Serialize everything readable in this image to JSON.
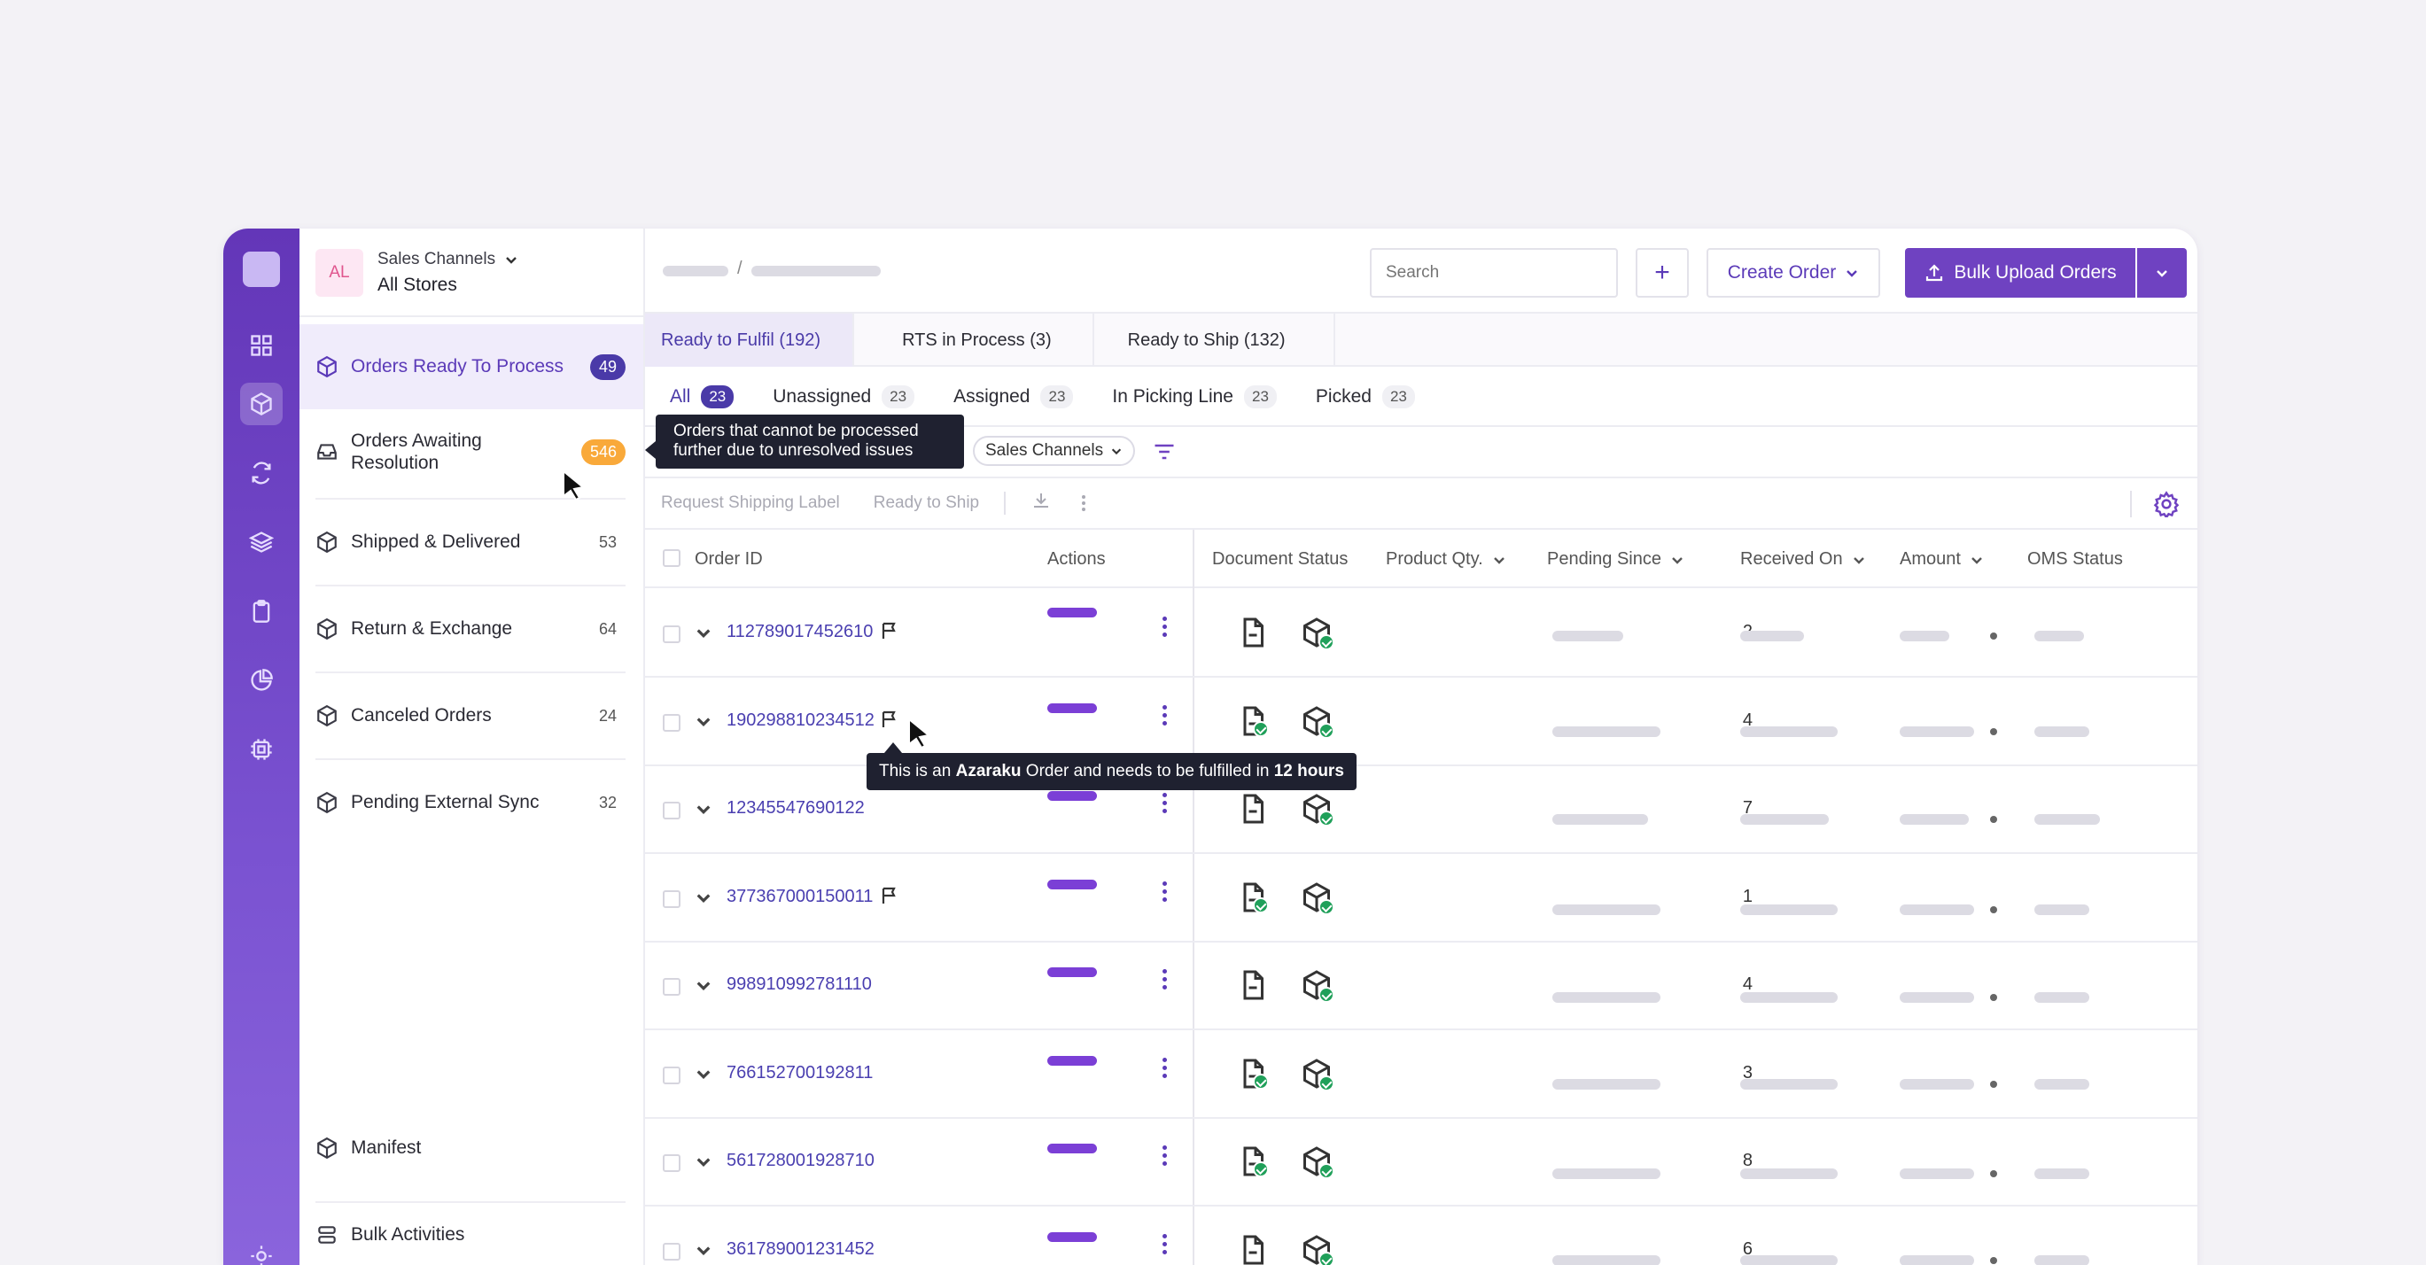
{
  "store": {
    "initials": "AL",
    "channel_label": "Sales Channels",
    "store_name": "All Stores"
  },
  "sidebar": {
    "items": [
      {
        "label": "Orders Ready To Process",
        "count": "49",
        "icon": "box-icon"
      },
      {
        "label": "Orders Awaiting Resolution",
        "count": "546",
        "icon": "inbox-icon"
      },
      {
        "label": "Shipped & Delivered",
        "count": "53",
        "icon": "box-icon"
      },
      {
        "label": "Return & Exchange",
        "count": "64",
        "icon": "box-icon"
      },
      {
        "label": "Canceled Orders",
        "count": "24",
        "icon": "box-icon"
      },
      {
        "label": "Pending External Sync",
        "count": "32",
        "icon": "box-icon"
      }
    ],
    "bottom": [
      {
        "label": "Manifest",
        "icon": "box-icon"
      },
      {
        "label": "Bulk Activities",
        "icon": "stack-icon"
      }
    ]
  },
  "tooltips": {
    "resolution": "Orders that cannot be processed further due to unresolved issues",
    "order_pre": "This is an ",
    "order_brand": "Azaraku",
    "order_mid": " Order and needs to be fulfilled in ",
    "order_time": "12 hours"
  },
  "header": {
    "search_placeholder": "Search",
    "plus": "+",
    "create_order": "Create Order",
    "bulk_upload": "Bulk Upload Orders",
    "crumb_sep": "/"
  },
  "tabs": [
    "Ready to Fulfil (192)",
    "RTS in Process (3)",
    "Ready to Ship (132)"
  ],
  "subtabs": [
    {
      "label": "All",
      "count": "23"
    },
    {
      "label": "Unassigned",
      "count": "23"
    },
    {
      "label": "Assigned",
      "count": "23"
    },
    {
      "label": "In Picking Line",
      "count": "23"
    },
    {
      "label": "Picked",
      "count": "23"
    }
  ],
  "filters": {
    "channel_chip": "Sales Channels"
  },
  "actions": {
    "request_label": "Request Shipping Label",
    "ready_to_ship": "Ready to Ship"
  },
  "table": {
    "headers": {
      "order_id": "Order ID",
      "actions": "Actions",
      "document_status": "Document Status",
      "product_qty": "Product Qty.",
      "pending_since": "Pending Since",
      "received_on": "Received On",
      "amount": "Amount",
      "oms_status": "OMS Status"
    },
    "rows": [
      {
        "order_id": "112789017452610",
        "qty": "2",
        "flag": true,
        "doc_ok": false
      },
      {
        "order_id": "190298810234512",
        "qty": "4",
        "flag": true,
        "doc_ok": true
      },
      {
        "order_id": "12345547690122",
        "qty": "7",
        "flag": false,
        "doc_ok": false
      },
      {
        "order_id": "377367000150011",
        "qty": "1",
        "flag": true,
        "doc_ok": true
      },
      {
        "order_id": "998910992781110",
        "qty": "4",
        "flag": false,
        "doc_ok": false
      },
      {
        "order_id": "766152700192811",
        "qty": "3",
        "flag": false,
        "doc_ok": true
      },
      {
        "order_id": "561728001928710",
        "qty": "8",
        "flag": false,
        "doc_ok": true
      },
      {
        "order_id": "361789001231452",
        "qty": "6",
        "flag": false,
        "doc_ok": false
      }
    ]
  },
  "colors": {
    "brand": "#6f42c1",
    "accent_dark": "#4a3aa8",
    "warning": "#f9a93a",
    "success": "#20a05a"
  }
}
